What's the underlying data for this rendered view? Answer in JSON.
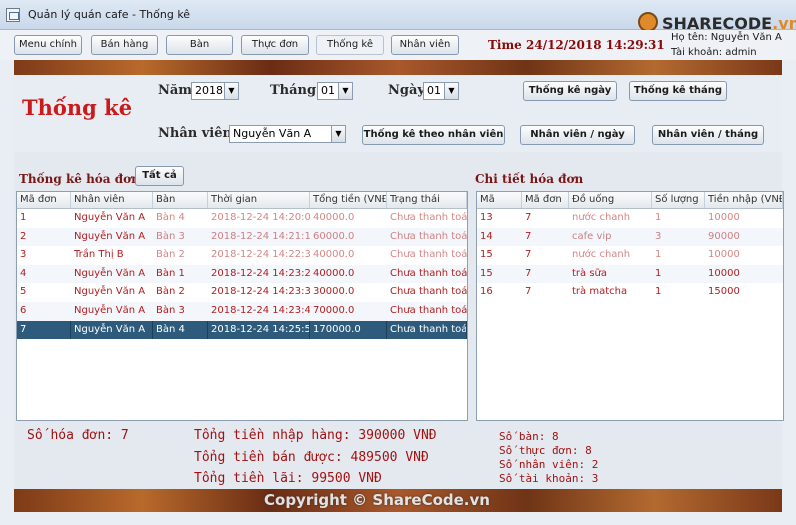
{
  "window": {
    "title": "Quản lý quán cafe - Thống kê"
  },
  "watermark_logo": {
    "brand": "SHARECODE",
    "suffix": ".vn"
  },
  "nav": [
    "Menu chính",
    "Bán hàng",
    "Bàn",
    "Thực đơn",
    "Thống kê",
    "Nhân viên"
  ],
  "time": "Time 24/12/2018 14:29:31",
  "user": {
    "name": "Họ tên: Nguyễn Văn A",
    "account": "Tài khoản: admin"
  },
  "filter": {
    "title": "Thống kê",
    "year_label": "Năm",
    "year_value": "2018",
    "month_label": "Tháng",
    "month_value": "01",
    "day_label": "Ngày",
    "day_value": "01",
    "btn_day": "Thống kê ngày",
    "btn_month": "Thống kê tháng",
    "staff_label": "Nhân viên:",
    "staff_value": "Nguyễn Văn A",
    "btn_by_staff": "Thống kê theo nhân viên",
    "btn_staff_day": "Nhân viên / ngày",
    "btn_staff_month": "Nhân viên / tháng"
  },
  "invoices": {
    "title": "Thống kê hóa đơn",
    "all_button": "Tất cả",
    "headers": [
      "Mã đơn",
      "Nhân viên",
      "Bàn",
      "Thời gian",
      "Tổng tiền (VNĐ)",
      "Trạng thái"
    ],
    "rows": [
      [
        "1",
        "Nguyễn Văn A",
        "Bàn 4",
        "2018-12-24 14:20:05",
        "40000.0",
        "Chưa thanh toán"
      ],
      [
        "2",
        "Nguyễn Văn A",
        "Bàn 3",
        "2018-12-24 14:21:12",
        "60000.0",
        "Chưa thanh toán"
      ],
      [
        "3",
        "Trần Thị B",
        "Bàn 2",
        "2018-12-24 14:22:30",
        "40000.0",
        "Chưa thanh toán"
      ],
      [
        "4",
        "Nguyễn Văn A",
        "Bàn 1",
        "2018-12-24 14:23:25",
        "40000.0",
        "Chưa thanh toán"
      ],
      [
        "5",
        "Nguyễn Văn A",
        "Bàn 2",
        "2018-12-24 14:23:33",
        "30000.0",
        "Chưa thanh toán"
      ],
      [
        "6",
        "Nguyễn Văn A",
        "Bàn 3",
        "2018-12-24 14:23:42",
        "70000.0",
        "Chưa thanh toán"
      ],
      [
        "7",
        "Nguyễn Văn A",
        "Bàn 4",
        "2018-12-24 14:25:51",
        "170000.0",
        "Chưa thanh toán"
      ]
    ],
    "obscured_rows": [
      0,
      1,
      2
    ],
    "selected_row": 6
  },
  "details": {
    "title": "Chi tiết hóa đơn",
    "headers": [
      "Mã",
      "Mã đơn",
      "Đồ uống",
      "Số lượng",
      "Tiền nhập (VNĐ)"
    ],
    "rows": [
      [
        "13",
        "7",
        "nước chanh",
        "1",
        "10000"
      ],
      [
        "14",
        "7",
        "cafe vip",
        "3",
        "90000"
      ],
      [
        "15",
        "7",
        "nước chanh",
        "1",
        "10000"
      ],
      [
        "15",
        "7",
        "trà sữa",
        "1",
        "10000"
      ],
      [
        "16",
        "7",
        "trà matcha",
        "1",
        "15000"
      ]
    ],
    "obscured_rows": [
      0,
      1,
      2
    ]
  },
  "stats": {
    "invoice_count": "Số hóa đơn: 7",
    "total_import": "Tổng tiền nhập hàng: 390000 VNĐ",
    "total_sales": "Tổng tiền bán được: 489500 VNĐ",
    "total_profit": "Tổng tiền lãi: 99500 VNĐ",
    "tables": "Số bàn: 8",
    "menu_items": "Số thực đơn: 8",
    "staff": "Số nhân viên: 2",
    "accounts": "Số tài khoản: 3"
  },
  "copyright": "Copyright © ShareCode.vn",
  "colors": {
    "accent_red": "#a31212",
    "selected_row": "#2e5b7c",
    "brown_strip": "#7e3a18"
  }
}
